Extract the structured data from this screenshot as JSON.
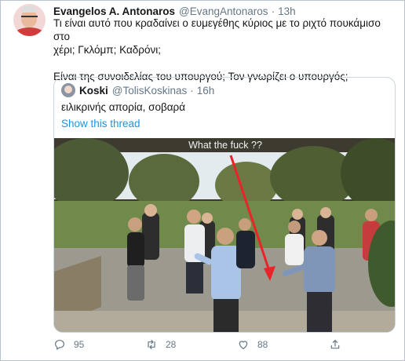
{
  "tweet": {
    "author_name": "Evangelos A. Antonaros",
    "author_handle": "@EvangAntonaros",
    "separator": "·",
    "time": "13h",
    "text_line1": "Τι είναι αυτό που κραδαίνει ο ευμεγέθης κύριος με το ριχτό πουκάμισο στο",
    "text_line2": "χέρι; Γκλόμπ; Καδρόνι;",
    "text_line3": "Είναι της συνοιδελίας του υπουργού; Τον γνωρίζει ο υπουργός;"
  },
  "quote": {
    "author_name": "Koski",
    "author_handle": "@TolisKoskinas",
    "separator": "·",
    "time": "16h",
    "text": "ειλικρινής απορία, σοβαρά",
    "thread_link": "Show this thread",
    "media_caption": "What the fuck ??"
  },
  "actions": {
    "reply_count": "95",
    "retweet_count": "28",
    "like_count": "88",
    "reply_icon": "reply-icon",
    "retweet_icon": "retweet-icon",
    "like_icon": "heart-icon",
    "share_icon": "share-icon"
  },
  "colors": {
    "link": "#1b95e0",
    "secondary_text": "#657786",
    "arrow": "#e8232a"
  }
}
